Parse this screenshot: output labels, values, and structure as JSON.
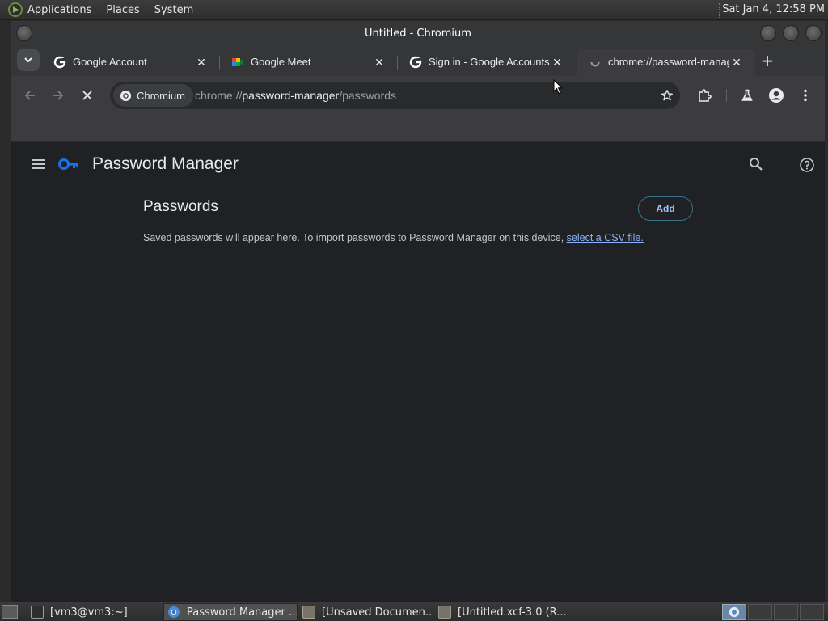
{
  "top_panel": {
    "menus": [
      "Applications",
      "Places",
      "System"
    ],
    "clock": "Sat Jan  4, 12:58 PM"
  },
  "window": {
    "title": "Untitled - Chromium"
  },
  "tabs": [
    {
      "title": "Google Account",
      "favicon": "google-g-icon"
    },
    {
      "title": "Google Meet",
      "favicon": "google-meet-icon"
    },
    {
      "title": "Sign in - Google Accounts",
      "favicon": "google-g-icon"
    },
    {
      "title": "chrome://password-manager",
      "favicon": "loading-spinner-icon",
      "active": true
    }
  ],
  "omnibox": {
    "site_chip": "Chromium",
    "url_scheme": "chrome://",
    "url_host": "password-manager",
    "url_path": "/passwords"
  },
  "page": {
    "app_title": "Password Manager",
    "section_title": "Passwords",
    "add_label": "Add",
    "empty_message": "Saved passwords will appear here. To import passwords to Password Manager on this device, ",
    "csv_link": "select a CSV file."
  },
  "taskbar": {
    "items": [
      {
        "label": "[vm3@vm3:~]",
        "icon": "terminal-icon",
        "active": false
      },
      {
        "label": "Password Manager ...",
        "icon": "chromium-icon",
        "active": true
      },
      {
        "label": "[Unsaved Documen...",
        "icon": "text-editor-icon",
        "active": false
      },
      {
        "label": "[Untitled.xcf-3.0 (R...",
        "icon": "gimp-icon",
        "active": false
      }
    ]
  },
  "colors": {
    "accent": "#8ab4f8",
    "page_bg": "#202124",
    "toolbar_bg": "#3c3c3e",
    "key_icon": "#1a73e8"
  }
}
